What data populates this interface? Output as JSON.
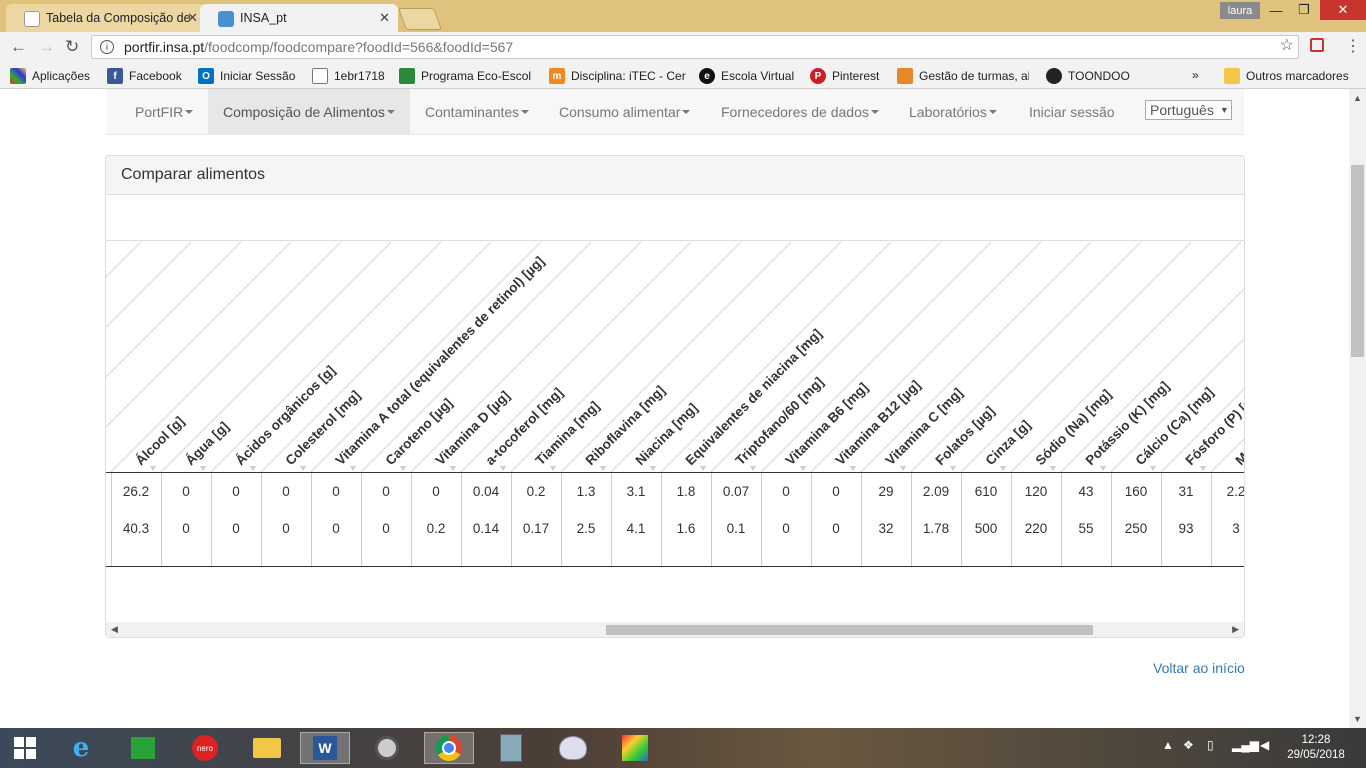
{
  "browser": {
    "tabs": [
      {
        "title": "Tabela da Composição de",
        "active": false
      },
      {
        "title": "INSA_pt",
        "active": true
      }
    ],
    "user": "laura",
    "url_host": "portfir.insa.pt",
    "url_path": "/foodcomp/foodcompare?foodId=566&foodId=567"
  },
  "bookmarks": {
    "items": [
      {
        "label": "Aplicações",
        "icon": "apps-icon"
      },
      {
        "label": "Facebook",
        "icon": "facebook-icon"
      },
      {
        "label": "Iniciar Sessão",
        "icon": "outlook-icon"
      },
      {
        "label": "1ebr1718",
        "icon": "page-icon"
      },
      {
        "label": "Programa Eco-Escola",
        "icon": "eco-icon"
      },
      {
        "label": "Disciplina: iTEC - Cer",
        "icon": "moodle-icon"
      },
      {
        "label": "Escola Virtual",
        "icon": "escola-virtual-icon"
      },
      {
        "label": "Pinterest",
        "icon": "pinterest-icon"
      },
      {
        "label": "Gestão de turmas, al",
        "icon": "gestao-icon"
      },
      {
        "label": "TOONDOO",
        "icon": "toondoo-icon"
      }
    ],
    "more": "»",
    "other": "Outros marcadores"
  },
  "nav": {
    "items": [
      {
        "label": "PortFIR",
        "caret": true,
        "active": false
      },
      {
        "label": "Composição de Alimentos",
        "caret": true,
        "active": true
      },
      {
        "label": "Contaminantes",
        "caret": true,
        "active": false
      },
      {
        "label": "Consumo alimentar",
        "caret": true,
        "active": false
      },
      {
        "label": "Fornecedores de dados",
        "caret": true,
        "active": false
      },
      {
        "label": "Laboratórios",
        "caret": true,
        "active": false
      },
      {
        "label": "Iniciar sessão",
        "caret": false,
        "active": false
      }
    ],
    "language": "Português"
  },
  "panel": {
    "title": "Comparar alimentos"
  },
  "table": {
    "columns": [
      "Álcool [g]",
      "Água [g]",
      "Ácidos orgânicos [g]",
      "Colesterol [mg]",
      "Vitamina A total (equivalentes de retinol) [µg]",
      "Caroteno [µg]",
      "Vitamina D [µg]",
      "a-tocoferol [mg]",
      "Tiamina [mg]",
      "Riboflavina [mg]",
      "Niacina [mg]",
      "Equivalentes de niacina [mg]",
      "Triptofano/60 [mg]",
      "Vitamina B6 [mg]",
      "Vitamina B12 [µg]",
      "Vitamina C [mg]",
      "Folatos [µg]",
      "Cinza [g]",
      "Sódio (Na) [mg]",
      "Potássio (K) [mg]",
      "Cálcio (Ca) [mg]",
      "Fósforo (P) [mg]",
      "Magnésio (Mg) [mg]"
    ],
    "rows": [
      [
        "26.2",
        "0",
        "0",
        "0",
        "0",
        "0",
        "0",
        "0.04",
        "0.2",
        "1.3",
        "3.1",
        "1.8",
        "0.07",
        "0",
        "0",
        "29",
        "2.09",
        "610",
        "120",
        "43",
        "160",
        "31",
        "2.2"
      ],
      [
        "40.3",
        "0",
        "0",
        "0",
        "0",
        "0",
        "0.2",
        "0.14",
        "0.17",
        "2.5",
        "4.1",
        "1.6",
        "0.1",
        "0",
        "0",
        "32",
        "1.78",
        "500",
        "220",
        "55",
        "250",
        "93",
        "3"
      ]
    ]
  },
  "footer": {
    "back_link": "Voltar ao início"
  },
  "taskbar": {
    "time": "12:28",
    "date": "29/05/2018"
  },
  "colors": {
    "titlebar": "#dfc27b",
    "link": "#337ab7",
    "nav_active_bg": "#e7e7e7"
  }
}
